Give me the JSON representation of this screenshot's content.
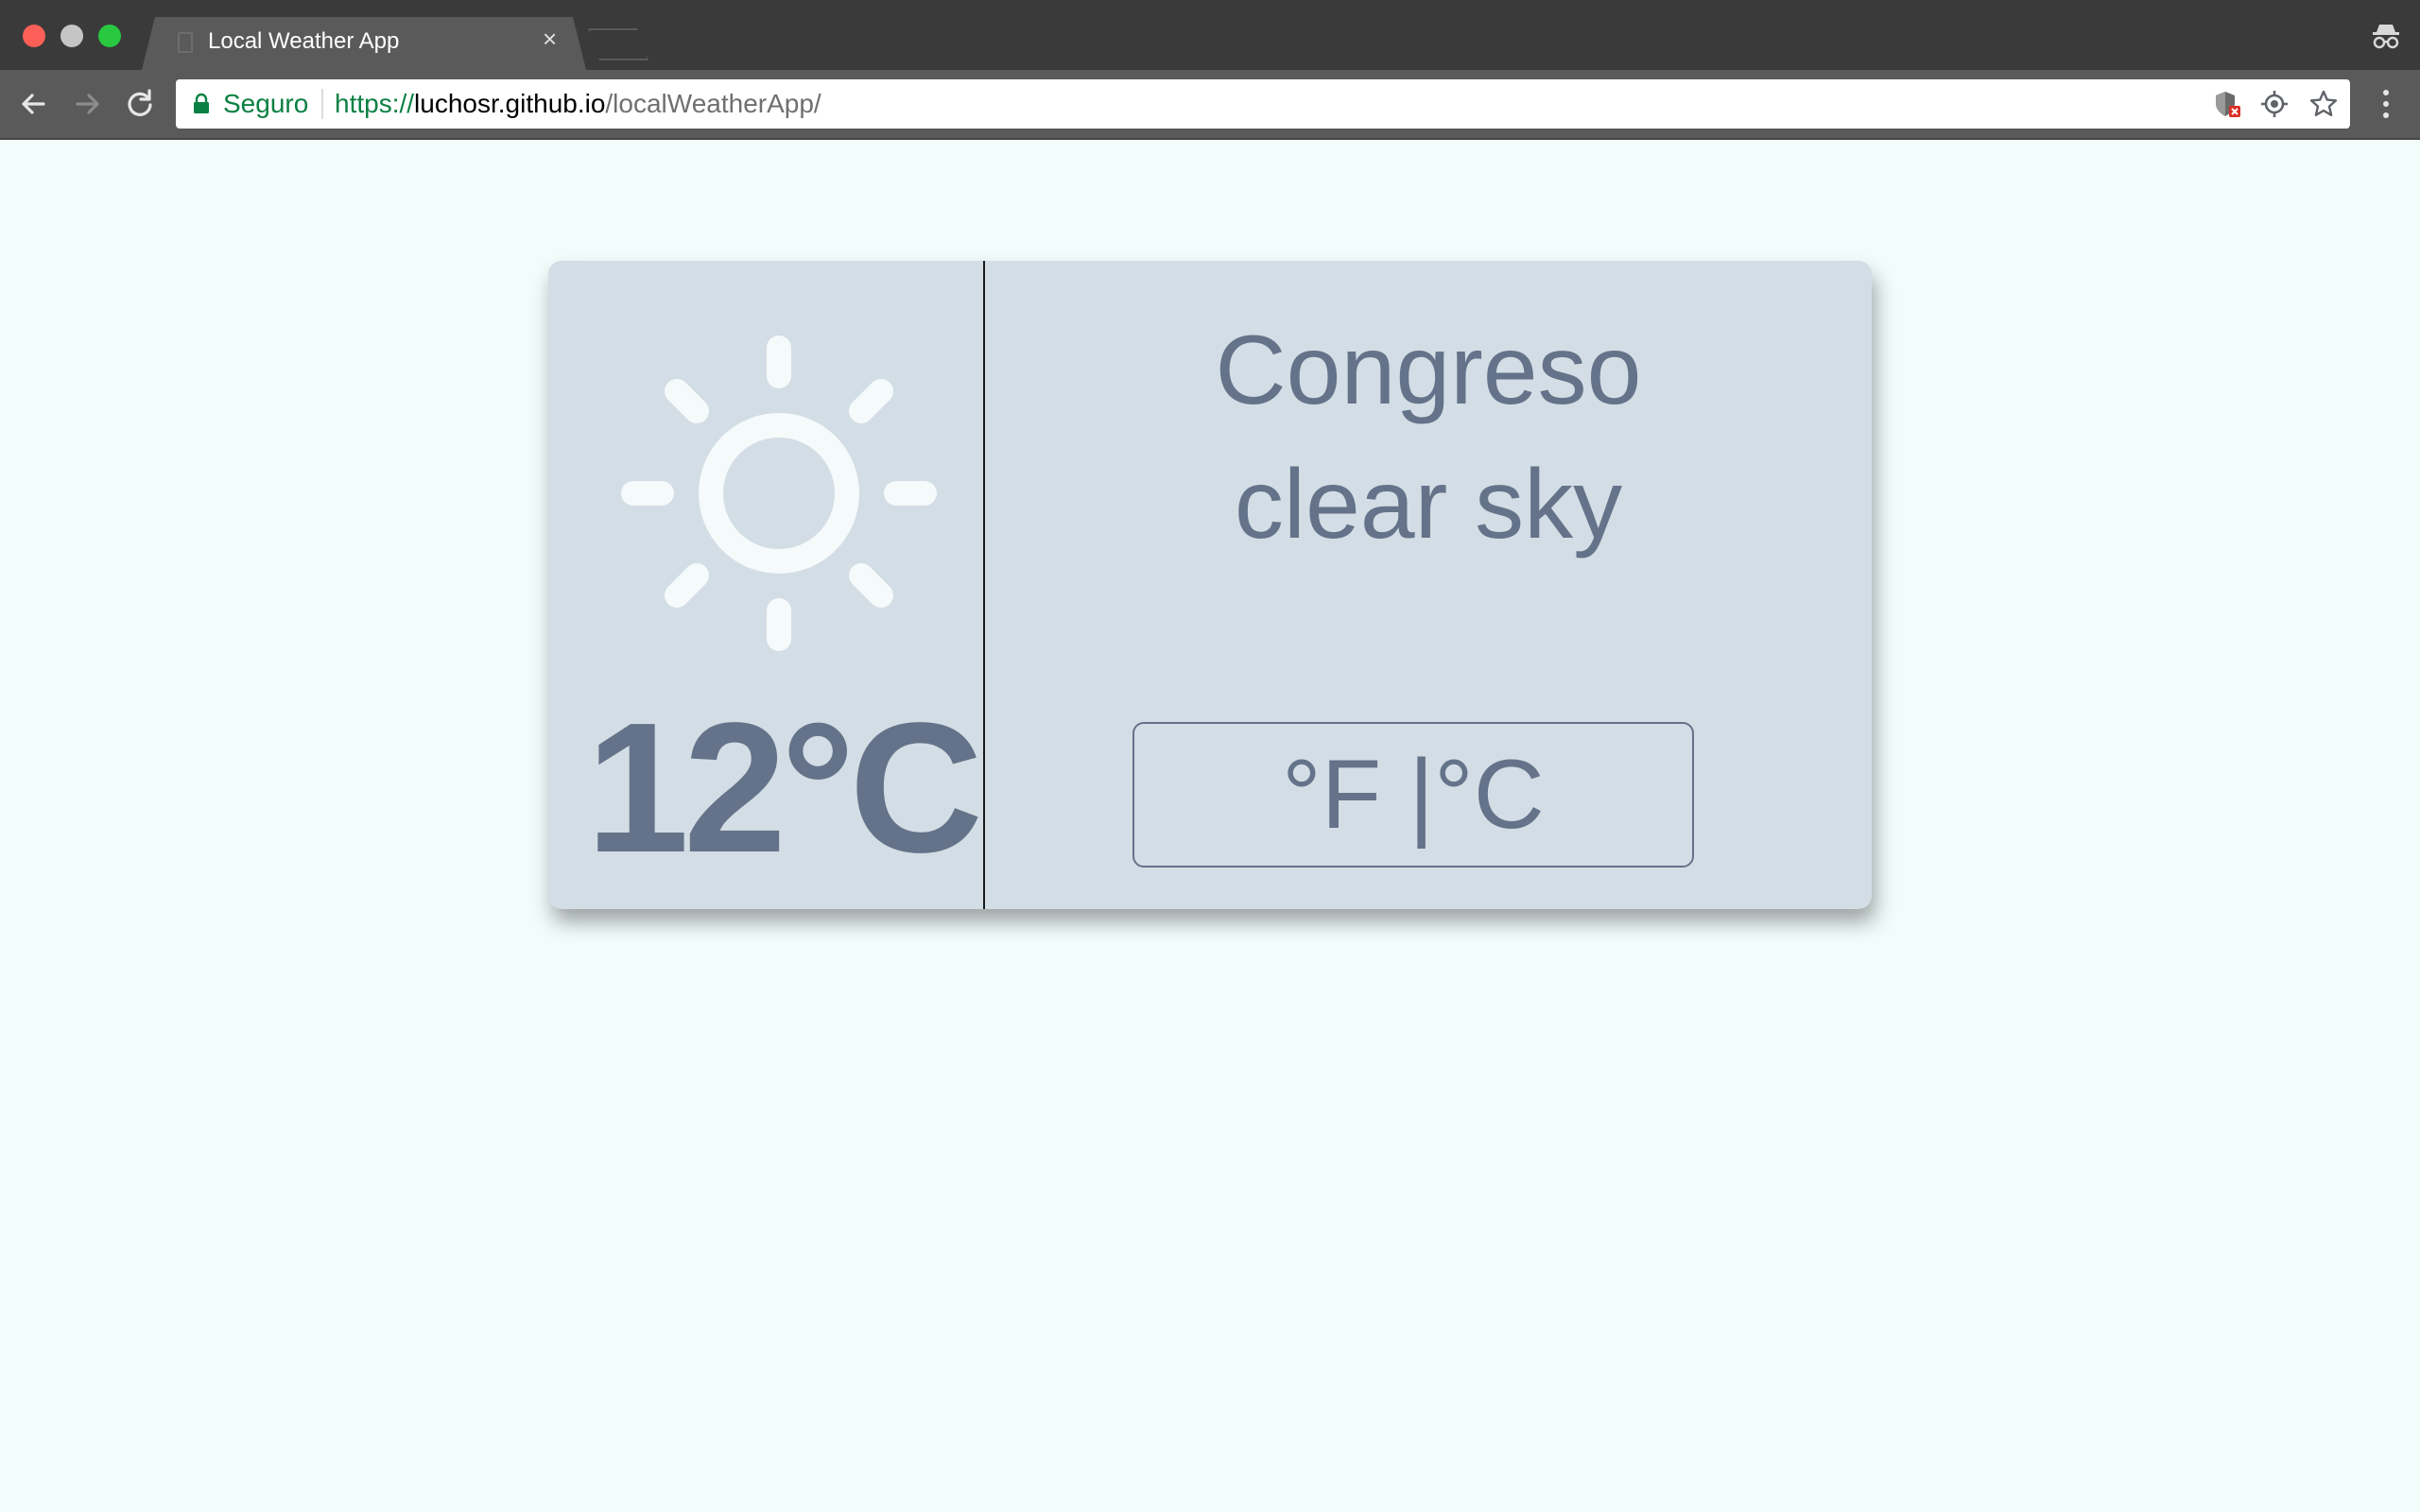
{
  "browser": {
    "tab_title": "Local Weather App",
    "tab_close": "×",
    "secure_label": "Seguro",
    "url_scheme": "https://",
    "url_host": "luchosr.github.io",
    "url_path": "/localWeatherApp/",
    "icons": [
      "back-icon",
      "forward-icon",
      "reload-icon",
      "lock-icon",
      "shield-icon",
      "location-target-icon",
      "star-icon",
      "menu-icon",
      "incognito-icon"
    ]
  },
  "weather": {
    "icon": "sun-icon",
    "temperature": "12°C",
    "city": "Congreso",
    "description": "clear sky",
    "unit_toggle_label": "°F |°C"
  },
  "colors": {
    "page_background": "#f2fdfb",
    "card_background": "#d3dde5",
    "text": "#647389",
    "sun": "#f5fafa"
  }
}
